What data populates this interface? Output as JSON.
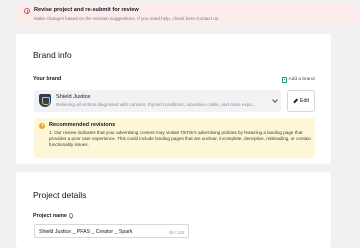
{
  "alert": {
    "title": "Revise project and re-submit for review",
    "subtitle": "Make changes based on the revision suggestions. If you need help, check here Contact us."
  },
  "brand_info": {
    "heading": "Brand info",
    "your_brand_label": "Your brand",
    "add_brand_label": "Add a brand",
    "selected_brand": {
      "name": "Shield Justice",
      "description": "Relieving all victims diagnosed with cancers, thyroid conditions, ulcerative colitis, and more expo..."
    },
    "edit_label": "Edit",
    "recommended": {
      "title": "Recommended revisions",
      "items": [
        "1. Our review indicates that your advertising content may violate TikTok's advertising policies by featuring a landing page that provides a poor user experience. This could include landing pages that are unclear, incomplete, deceptive, misleading, or contain functionality issues."
      ]
    }
  },
  "project_details": {
    "heading": "Project details",
    "project_name_label": "Project name",
    "project_name_value": "Shield Justice _ PFAS _ Creator _ Spark",
    "char_count": "39 / 120"
  },
  "colors": {
    "page_bg": "#f1f1f2",
    "alert_bg": "#fdecec",
    "error_accent": "#e0505a",
    "warning_bg": "#fdf7d7",
    "warning_accent": "#f0a920",
    "brand_accent": "#1fa37a"
  }
}
